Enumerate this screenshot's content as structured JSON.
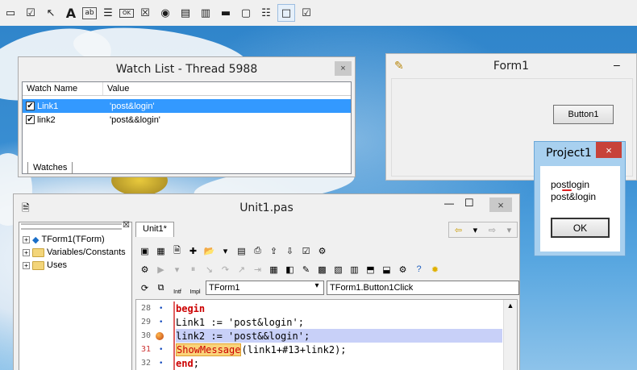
{
  "palette": {
    "items": [
      "edit-icon",
      "checkbox-icon",
      "pointer-icon",
      "label-icon",
      "edit-field-icon",
      "memo-icon",
      "button-icon",
      "checkbox-x-icon",
      "radio-icon",
      "listbox-icon",
      "combobox-icon",
      "scrollbar-icon",
      "groupbox-icon",
      "radiogroup-icon",
      "panel-icon",
      "actionlist-icon"
    ],
    "label_A": "A",
    "label_ab": "ab",
    "label_ok": "OK"
  },
  "watch": {
    "title": "Watch List - Thread 5988",
    "close": "×",
    "col_name": "Watch Name",
    "col_value": "Value",
    "rows": [
      {
        "name": "Link1",
        "value": "'post&login'"
      },
      {
        "name": "link2",
        "value": "'post&&login'"
      }
    ],
    "tab": "Watches"
  },
  "form1": {
    "title": "Form1",
    "minimize": "–",
    "button": "Button1"
  },
  "project1": {
    "title": "Project1",
    "close": "×",
    "line1": "postlogin",
    "line2": "post&login",
    "ok": "OK"
  },
  "unit": {
    "title": "Unit1.pas",
    "minimize": "—",
    "maximize": "☐",
    "close": "×",
    "tab": "Unit1*",
    "tree": [
      {
        "expander": "+",
        "label": "TForm1(TForm)"
      },
      {
        "expander": "+",
        "label": "Variables/Constants"
      },
      {
        "expander": "+",
        "label": "Uses"
      }
    ],
    "class_combo": "TForm1",
    "method_combo": "TForm1.Button1Click",
    "intf": "Intf",
    "impl": "Impl",
    "lines": [
      {
        "num": "28",
        "kw": "begin",
        "rest": ""
      },
      {
        "num": "29",
        "kw": "",
        "rest": "Link1 := 'post&login';"
      },
      {
        "num": "30",
        "kw": "",
        "rest": "link2 := 'post&&login';"
      },
      {
        "num": "31",
        "kw": "ShowMessage",
        "rest": "(link1+#13+link2);"
      },
      {
        "num": "32",
        "kw": "end",
        "rest": ";"
      }
    ]
  },
  "colors": {
    "accent": "#3399ff",
    "close_red": "#c7423a",
    "breakpoint": "#c8d0f8",
    "keyword": "#cc0000"
  }
}
